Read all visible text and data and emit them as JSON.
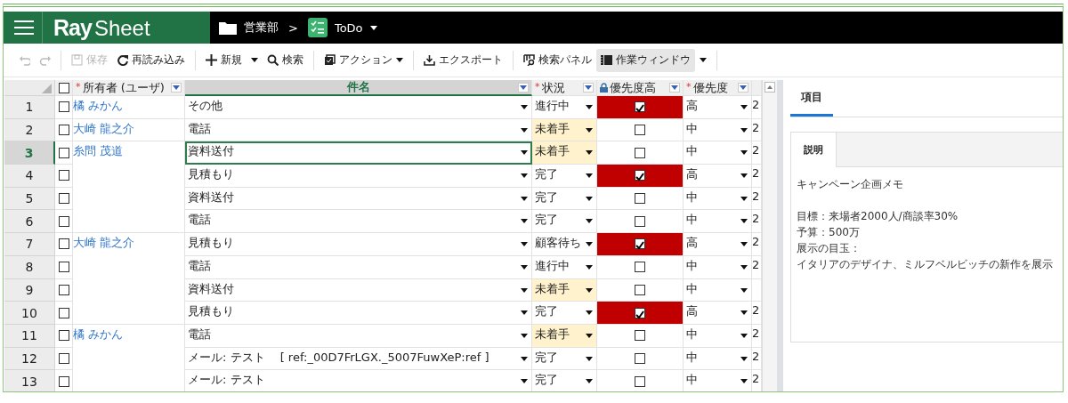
{
  "header": {
    "logo_bold": "Ray",
    "logo_light": "Sheet",
    "breadcrumb": [
      {
        "kind": "folder",
        "label": "営業部"
      },
      {
        "kind": "separator",
        "label": ">"
      },
      {
        "kind": "sheet",
        "label": "ToDo"
      }
    ]
  },
  "toolbar": [
    {
      "kind": "undo",
      "disabled": true
    },
    {
      "kind": "redo",
      "disabled": true
    },
    {
      "kind": "divider"
    },
    {
      "kind": "save",
      "label": "保存",
      "disabled": true
    },
    {
      "kind": "reload",
      "label": "再読み込み",
      "disabled": false
    },
    {
      "kind": "divider"
    },
    {
      "kind": "new",
      "label": "新規",
      "disabled": false
    },
    {
      "kind": "menu",
      "disabled": false
    },
    {
      "kind": "search",
      "label": "検索",
      "disabled": false
    },
    {
      "kind": "divider"
    },
    {
      "kind": "action",
      "label": "アクション",
      "disabled": false
    },
    {
      "kind": "divider"
    },
    {
      "kind": "export",
      "label": "エクスポート",
      "disabled": false
    },
    {
      "kind": "divider"
    },
    {
      "kind": "search_panel",
      "label": "検索パネル",
      "disabled": false,
      "on": false
    },
    {
      "kind": "work_window",
      "label": "作業ウィンドウ",
      "disabled": false,
      "on": true
    },
    {
      "kind": "menu",
      "disabled": false
    },
    {
      "kind": "divider"
    }
  ],
  "grid": {
    "all_checked": false,
    "columns": [
      {
        "marker": "*",
        "label": "所有者 (ユーザ)",
        "locked": false,
        "active": false
      },
      {
        "label": "件名",
        "locked": false,
        "active": true
      },
      {
        "marker": "*",
        "label": "状況",
        "locked": false,
        "active": false
      },
      {
        "label": "優先度高",
        "locked": true,
        "active": false
      },
      {
        "marker": "*",
        "label": "優先度",
        "locked": false,
        "active": false
      },
      {
        "locked": false,
        "active": false
      }
    ],
    "rows": [
      {
        "number": "1",
        "checked": false,
        "selected": false,
        "owner": "橘 みかん",
        "subject": "その他",
        "status": "進行中",
        "status_highlight": false,
        "high_priority": true,
        "priority": "高",
        "column_6": "2"
      },
      {
        "number": "2",
        "checked": false,
        "selected": false,
        "owner": "大崎 龍之介",
        "subject": "電話",
        "status": "未着手",
        "status_highlight": true,
        "high_priority": false,
        "priority": "中",
        "column_6": "2"
      },
      {
        "number": "3",
        "checked": false,
        "selected": true,
        "owner": "糸問 茂道",
        "subject": "資料送付",
        "status": "未着手",
        "status_highlight": true,
        "high_priority": false,
        "priority": "中",
        "column_6": "2"
      },
      {
        "number": "4",
        "checked": false,
        "selected": false,
        "subject": "見積もり",
        "status": "完了",
        "status_highlight": false,
        "high_priority": true,
        "priority": "高",
        "column_6": "2"
      },
      {
        "number": "5",
        "checked": false,
        "selected": false,
        "subject": "資料送付",
        "status": "完了",
        "status_highlight": false,
        "high_priority": false,
        "priority": "中",
        "column_6": "2"
      },
      {
        "number": "6",
        "checked": false,
        "selected": false,
        "subject": "電話",
        "status": "完了",
        "status_highlight": false,
        "high_priority": false,
        "priority": "中",
        "column_6": "2"
      },
      {
        "number": "7",
        "checked": false,
        "selected": false,
        "owner": "大崎 龍之介",
        "subject": "見積もり",
        "status": "顧客待ち",
        "status_highlight": false,
        "high_priority": true,
        "priority": "高",
        "column_6": "2"
      },
      {
        "number": "8",
        "checked": false,
        "selected": false,
        "subject": "電話",
        "status": "進行中",
        "status_highlight": false,
        "high_priority": false,
        "priority": "中",
        "column_6": "2"
      },
      {
        "number": "9",
        "checked": false,
        "selected": false,
        "subject": "資料送付",
        "status": "未着手",
        "status_highlight": true,
        "high_priority": false,
        "priority": "中"
      },
      {
        "number": "10",
        "checked": false,
        "selected": false,
        "subject": "見積もり",
        "status": "完了",
        "status_highlight": false,
        "high_priority": true,
        "priority": "高",
        "column_6": "2"
      },
      {
        "number": "11",
        "checked": false,
        "selected": false,
        "owner": "橘 みかん",
        "subject": "電話",
        "status": "未着手",
        "status_highlight": true,
        "high_priority": false,
        "priority": "中",
        "column_6": "2"
      },
      {
        "number": "12",
        "checked": false,
        "selected": false,
        "subject": "メール: テスト　 [ ref:_00D7FrLGX._5007FuwXeP:ref ]",
        "status": "完了",
        "status_highlight": false,
        "high_priority": false,
        "priority": "中",
        "column_6": "2"
      },
      {
        "number": "13",
        "checked": false,
        "selected": false,
        "subject": "メール: テスト",
        "status": "完了",
        "status_highlight": false,
        "high_priority": false,
        "priority": "中",
        "column_6": "2"
      }
    ]
  },
  "panel": {
    "tabs": [
      {
        "label": "項目",
        "selected": true
      }
    ],
    "inner_tabs": [
      {
        "label": "説明",
        "selected": true
      }
    ],
    "description": [
      [
        "キャンペーン企画メモ"
      ],
      [
        "目標：来場者2000人/商談率30%",
        "予算：500万",
        "展示の目玉：",
        "イタリアのデザイナ、ミルフベルビッチの新作を展示"
      ]
    ]
  }
}
